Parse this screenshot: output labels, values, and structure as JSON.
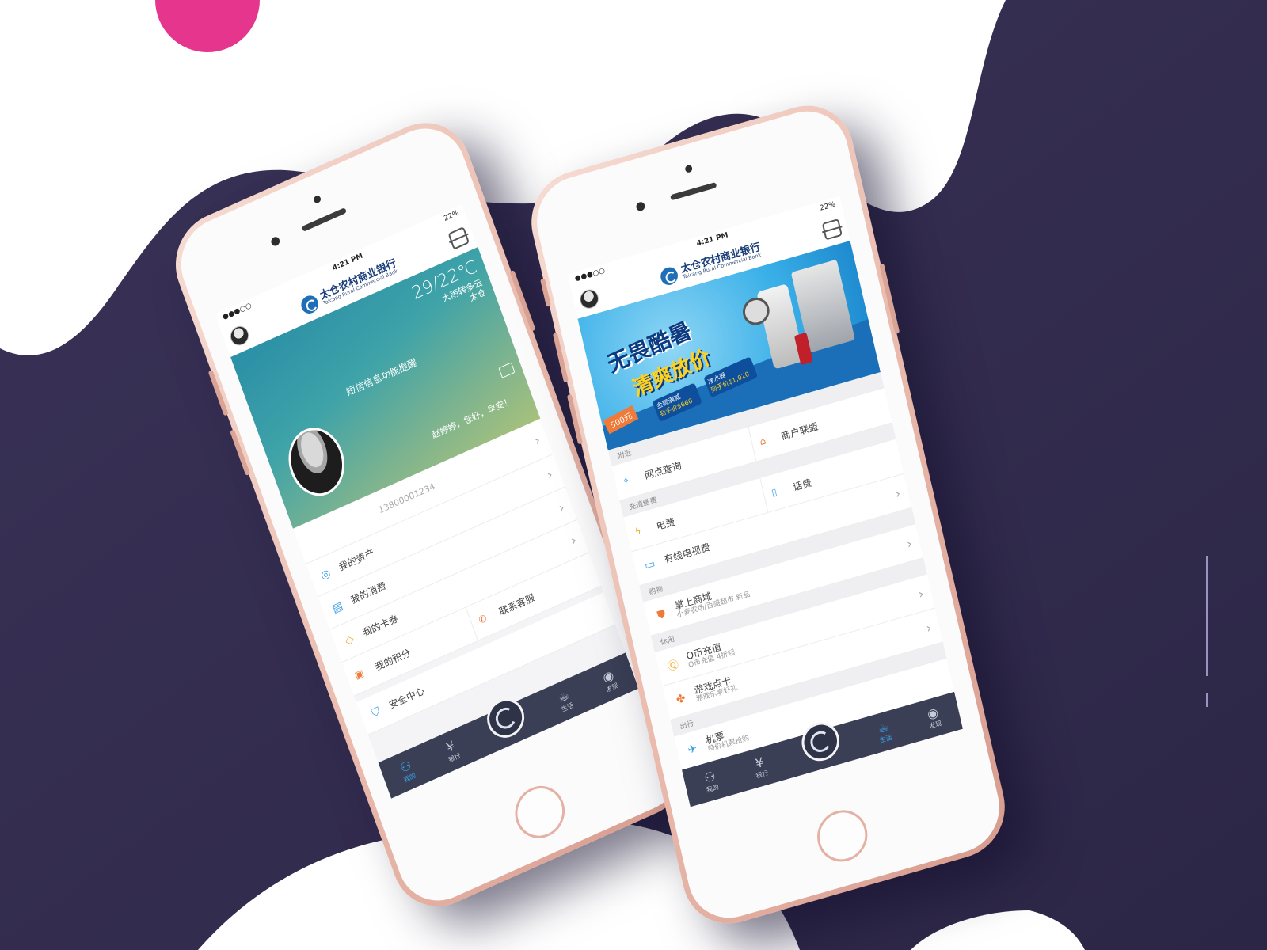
{
  "colors": {
    "background_dark": "#362f54",
    "pink_circle": "#e6358c",
    "tabbar": "#3a3f55",
    "tab_active": "#3aa0e8",
    "brand_blue": "#1e6fb8",
    "phone_rose_gold": "#e9b9ab"
  },
  "bank": {
    "name_cn": "太仓农村商业银行",
    "name_en": "Taicang Rural Commercial Bank"
  },
  "left_phone": {
    "status": {
      "time": "4:21 PM",
      "battery": "22%"
    },
    "weather": {
      "temperature": "29/22℃",
      "condition": "大雨转多云",
      "city": "太仓"
    },
    "login_notice": "短信信息功能提醒",
    "welcome": "赵婷婷，您好，早安！",
    "phone_number": "13800001234",
    "menu": [
      {
        "label": "我的资产",
        "icon": "asset-icon"
      },
      {
        "label": "我的消费",
        "icon": "bill-icon"
      },
      {
        "label": "我的卡券",
        "icon": "coupon-icon"
      },
      {
        "label": "我的积分",
        "icon": "points-icon"
      }
    ],
    "contact_label": "联系客服",
    "security_label": "安全中心",
    "tabs": [
      {
        "label": "我的",
        "icon": "user-icon",
        "active": true
      },
      {
        "label": "银行",
        "icon": "yuan-icon",
        "active": false
      },
      {
        "label": "生活",
        "icon": "cup-icon",
        "active": false
      },
      {
        "label": "发现",
        "icon": "discover-icon",
        "active": false
      }
    ]
  },
  "right_phone": {
    "status": {
      "time": "4:21 PM",
      "battery": "22%"
    },
    "banner": {
      "headline_1": "无畏酷暑",
      "headline_2": "清爽放价",
      "price_tag": "500元",
      "promo_1_title": "金额满减",
      "promo_1_price": "到手价$660",
      "promo_2_title": "净水器",
      "promo_2_price": "到手价$1,020"
    },
    "sections": {
      "nearby": "附近",
      "payments": "充值缴费",
      "shopping": "购物",
      "entertainment": "休闲",
      "travel": "出行"
    },
    "nearby_items": [
      {
        "label": "网点查询",
        "icon": "location-icon"
      },
      {
        "label": "商户联盟",
        "icon": "store-icon"
      }
    ],
    "payment_items": [
      {
        "label": "电费",
        "icon": "lightning-icon"
      },
      {
        "label": "话费",
        "icon": "mobile-icon"
      }
    ],
    "tv_fee": "有线电视费",
    "mall": {
      "title": "掌上商城",
      "subtitle": "小麦农场/百盛超市 新品"
    },
    "qb_recharge": {
      "title": "Q币充值",
      "subtitle": "Q币充值 4折起"
    },
    "game_card": {
      "title": "游戏点卡",
      "subtitle": "游戏乐享好礼"
    },
    "flight": {
      "title": "机票",
      "subtitle": "特价机票抢购"
    },
    "tabs": [
      {
        "label": "我的",
        "icon": "user-icon",
        "active": false
      },
      {
        "label": "银行",
        "icon": "yuan-icon",
        "active": false
      },
      {
        "label": "生活",
        "icon": "cup-icon",
        "active": true
      },
      {
        "label": "发现",
        "icon": "discover-icon",
        "active": false
      }
    ]
  }
}
